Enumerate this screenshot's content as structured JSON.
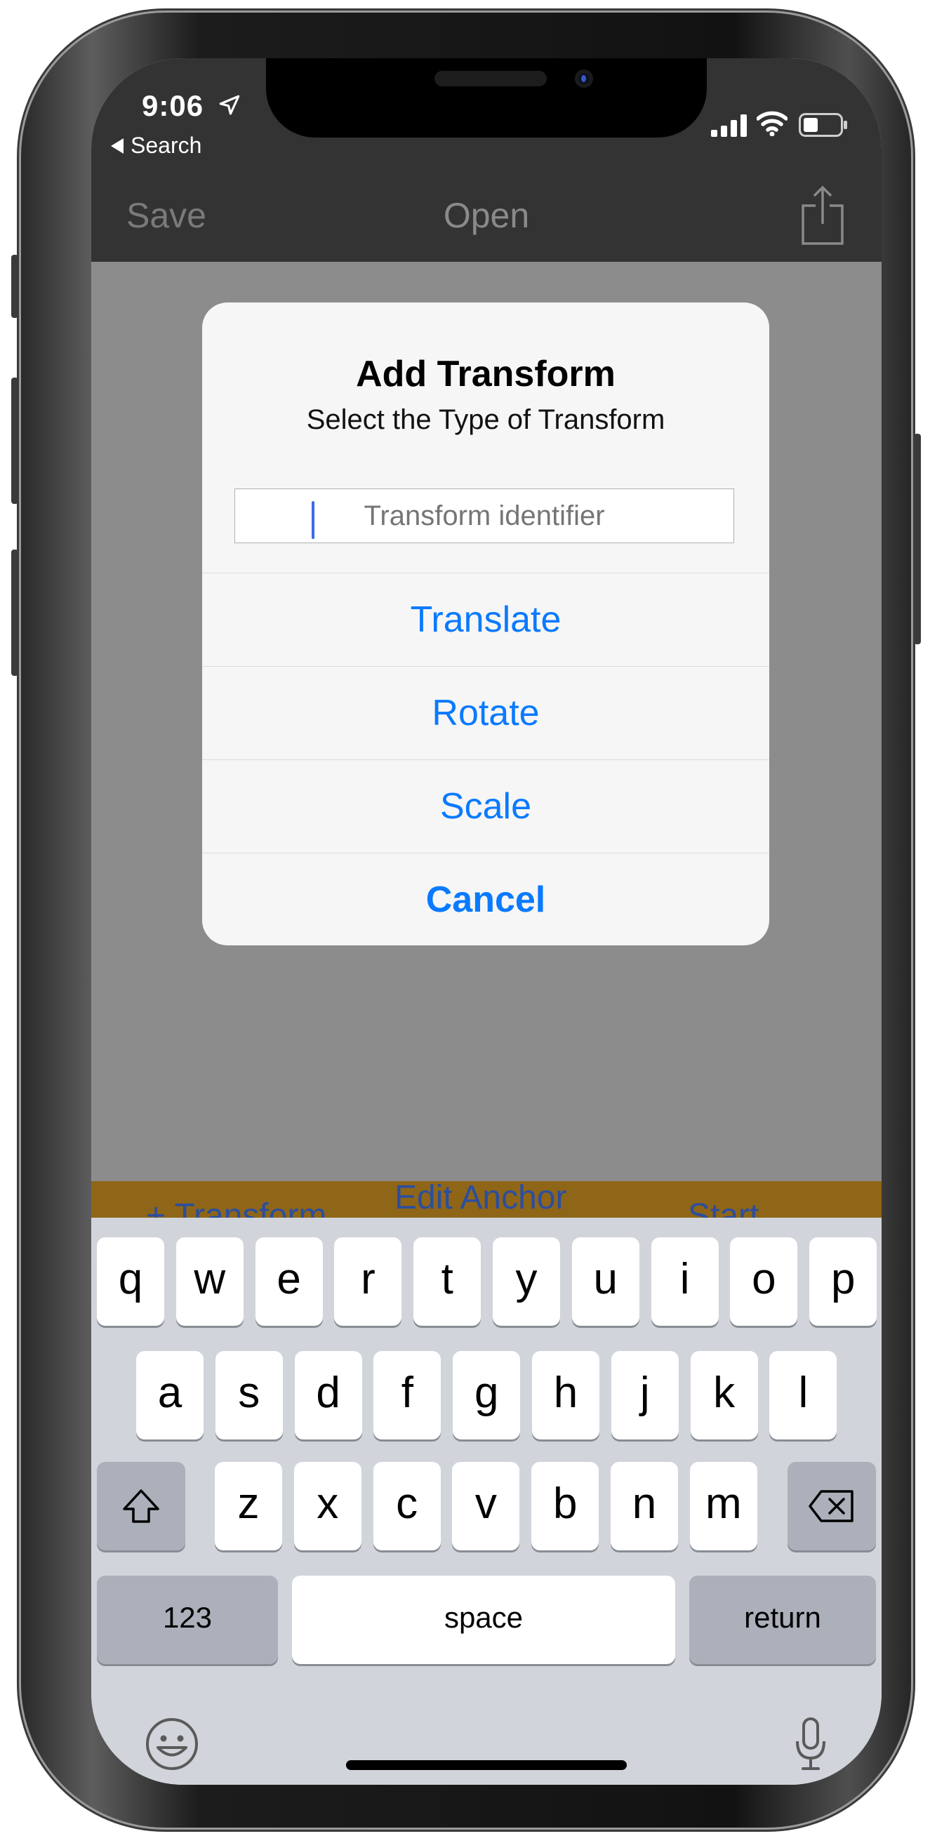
{
  "status_bar": {
    "time": "9:06",
    "back_label": "Search"
  },
  "nav_bar": {
    "save_label": "Save",
    "title": "Open"
  },
  "alert": {
    "title": "Add Transform",
    "message": "Select the Type of Transform",
    "input_placeholder": "Transform identifier",
    "input_value": "",
    "actions": [
      {
        "label": "Translate"
      },
      {
        "label": "Rotate"
      },
      {
        "label": "Scale"
      },
      {
        "label": "Cancel"
      }
    ]
  },
  "toolbar": {
    "transform_label": "+ Transform",
    "edit_anchor_label": "Edit Anchor",
    "start_label": "Start"
  },
  "keyboard": {
    "row1": [
      "q",
      "w",
      "e",
      "r",
      "t",
      "y",
      "u",
      "i",
      "o",
      "p"
    ],
    "row2": [
      "a",
      "s",
      "d",
      "f",
      "g",
      "h",
      "j",
      "k",
      "l"
    ],
    "row3": [
      "z",
      "x",
      "c",
      "v",
      "b",
      "n",
      "m"
    ],
    "numbers_label": "123",
    "space_label": "space",
    "return_label": "return"
  },
  "colors": {
    "accent": "#0a7aff",
    "toolbar_bg": "#8f6617",
    "nav_bg": "#333333"
  }
}
